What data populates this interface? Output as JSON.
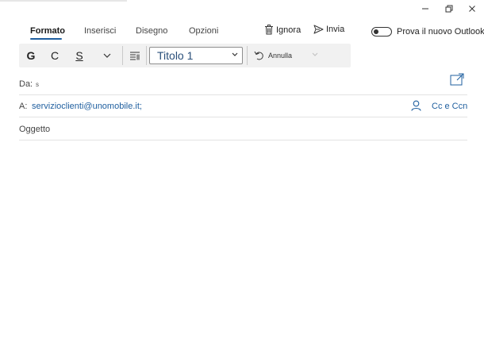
{
  "tabs": [
    {
      "label": "Formato",
      "active": true
    },
    {
      "label": "Inserisci",
      "active": false
    },
    {
      "label": "Disegno",
      "active": false
    },
    {
      "label": "Opzioni",
      "active": false
    }
  ],
  "actions": {
    "discard_label": "Ignora",
    "send_label": "Invia"
  },
  "new_outlook_toggle": {
    "label": "Prova il nuovo Outlook",
    "on": false
  },
  "format_toolbar": {
    "bold_glyph": "G",
    "italic_glyph": "C",
    "underline_glyph": "S",
    "style_value": "Titolo 1",
    "undo_label": "Annulla"
  },
  "compose": {
    "from_label": "Da:",
    "from_value": "s",
    "to_label": "A:",
    "to_value": "servizioclienti@unomobile.it;",
    "cc_label": "Cc e Ccn",
    "subject_placeholder": "Oggetto"
  },
  "colors": {
    "accent": "#1f5f9f",
    "toolbar_bg": "#f1f1f1"
  }
}
